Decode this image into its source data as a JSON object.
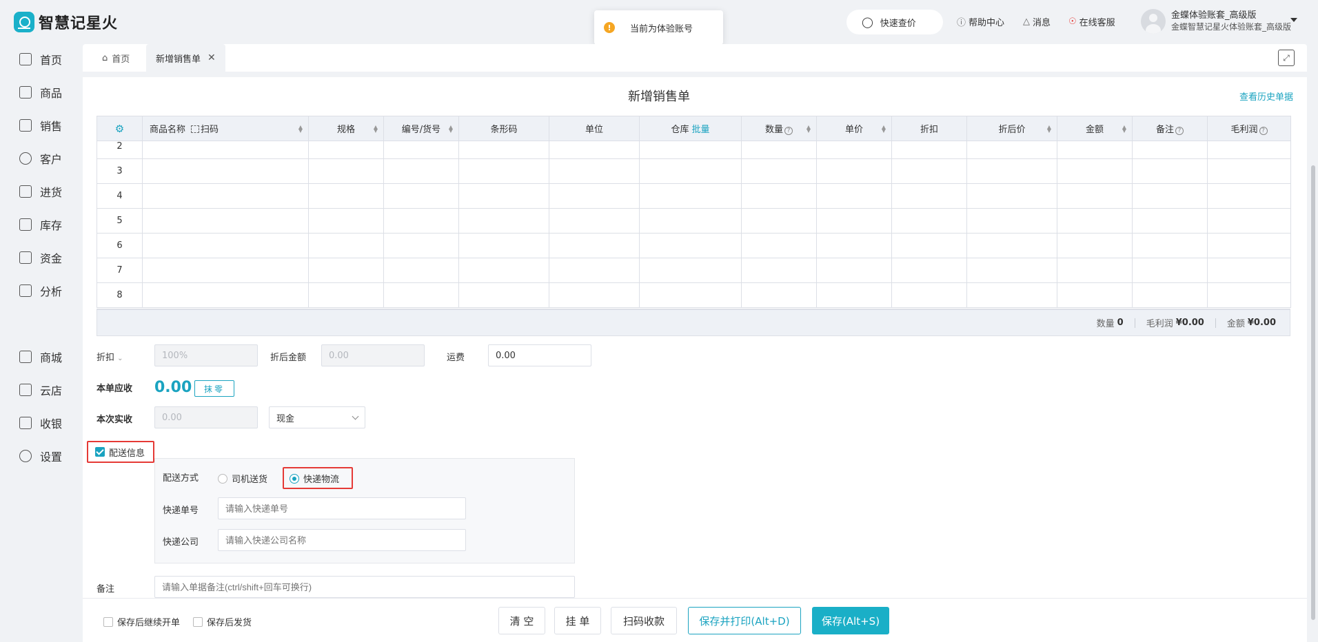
{
  "app": {
    "name": "智慧记星火"
  },
  "toast": {
    "text": "当前为体验账号"
  },
  "header": {
    "quick_search": "快速查价",
    "help": "帮助中心",
    "messages": "消息",
    "support": "在线客服",
    "user_name": "金蝶体验账套_高级版",
    "user_sub": "金蝶智慧记星火体验账套_高级版"
  },
  "sidebar": {
    "items": [
      {
        "label": "首页",
        "icon": "home-icon"
      },
      {
        "label": "商品",
        "icon": "goods-icon"
      },
      {
        "label": "销售",
        "icon": "sales-icon"
      },
      {
        "label": "客户",
        "icon": "customer-icon"
      },
      {
        "label": "进货",
        "icon": "purchase-icon"
      },
      {
        "label": "库存",
        "icon": "inventory-icon"
      },
      {
        "label": "资金",
        "icon": "funds-icon"
      },
      {
        "label": "分析",
        "icon": "analysis-icon"
      },
      {
        "label": "商城",
        "icon": "mall-icon"
      },
      {
        "label": "云店",
        "icon": "cloud-store-icon"
      },
      {
        "label": "收银",
        "icon": "cashier-icon"
      },
      {
        "label": "设置",
        "icon": "settings-icon"
      }
    ]
  },
  "tabs": [
    {
      "label": "首页"
    },
    {
      "label": "新增销售单"
    }
  ],
  "page": {
    "title": "新增销售单",
    "history_link": "查看历史单据"
  },
  "table": {
    "columns": {
      "name": "商品名称",
      "scan": "扫码",
      "spec": "规格",
      "code": "编号/货号",
      "barcode": "条形码",
      "unit": "单位",
      "warehouse": "仓库",
      "batch": "批量",
      "qty": "数量",
      "price": "单价",
      "discount": "折扣",
      "disc_price": "折后价",
      "amount": "金额",
      "remark": "备注",
      "profit": "毛利润"
    },
    "rows": [
      "2",
      "3",
      "4",
      "5",
      "6",
      "7",
      "8"
    ]
  },
  "summary": {
    "qty_label": "数量",
    "qty_value": "0",
    "profit_label": "毛利润",
    "profit_value": "¥0.00",
    "amount_label": "金额",
    "amount_value": "¥0.00"
  },
  "form": {
    "discount_label": "折扣",
    "discount_value": "100%",
    "disc_amount_label": "折后金额",
    "disc_amount_value": "0.00",
    "freight_label": "运费",
    "freight_value": "0.00",
    "receivable_label": "本单应收",
    "receivable_value": "0.00",
    "round_button": "抹零",
    "received_label": "本次实收",
    "received_value": "0.00",
    "pay_method": "现金",
    "delivery_checkbox": "配送信息",
    "delivery_method_label": "配送方式",
    "delivery_option_driver": "司机送货",
    "delivery_option_express": "快递物流",
    "tracking_label": "快递单号",
    "tracking_placeholder": "请输入快递单号",
    "company_label": "快递公司",
    "company_placeholder": "请输入快递公司名称",
    "remark_label": "备注",
    "remark_placeholder": "请输入单据备注(ctrl/shift+回车可换行)"
  },
  "footer": {
    "continue_label": "保存后继续开单",
    "ship_label": "保存后发货",
    "clear": "清 空",
    "hold": "挂 单",
    "scan_pay": "扫码收款",
    "save_print": "保存并打印(Alt+D)",
    "save": "保存(Alt+S)"
  },
  "colors": {
    "accent": "#1aafc7",
    "highlight": "#e53935"
  }
}
